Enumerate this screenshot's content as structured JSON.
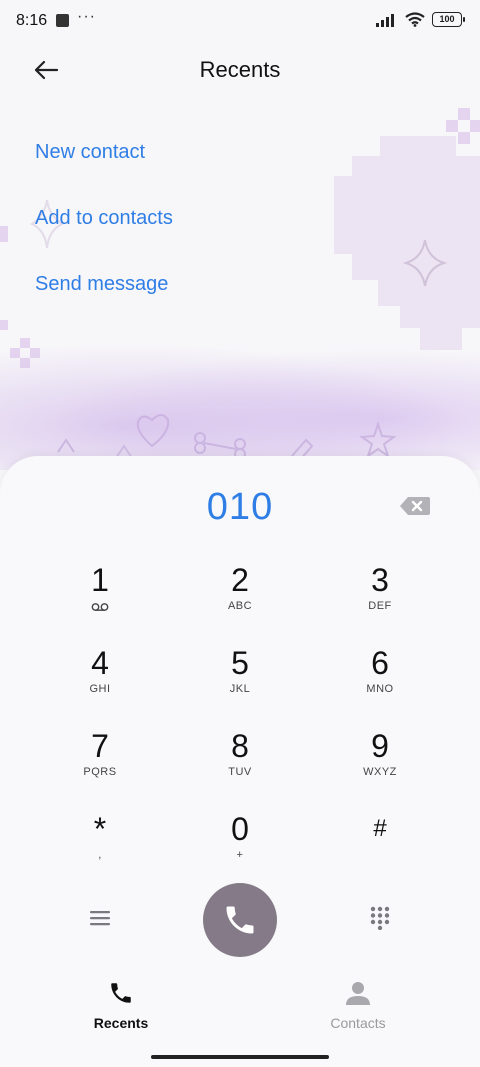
{
  "status_bar": {
    "time": "8:16",
    "dots": "···",
    "battery": "100"
  },
  "header": {
    "title": "Recents"
  },
  "actions": [
    {
      "label": "New contact"
    },
    {
      "label": "Add to contacts"
    },
    {
      "label": "Send message"
    }
  ],
  "dialer": {
    "number": "010",
    "keys": [
      {
        "digit": "1",
        "letters": ""
      },
      {
        "digit": "2",
        "letters": "ABC"
      },
      {
        "digit": "3",
        "letters": "DEF"
      },
      {
        "digit": "4",
        "letters": "GHI"
      },
      {
        "digit": "5",
        "letters": "JKL"
      },
      {
        "digit": "6",
        "letters": "MNO"
      },
      {
        "digit": "7",
        "letters": "PQRS"
      },
      {
        "digit": "8",
        "letters": "TUV"
      },
      {
        "digit": "9",
        "letters": "WXYZ"
      },
      {
        "digit": "*",
        "letters": ","
      },
      {
        "digit": "0",
        "letters": "+"
      },
      {
        "digit": "#",
        "letters": ""
      }
    ]
  },
  "tabs": [
    {
      "label": "Recents",
      "active": true
    },
    {
      "label": "Contacts",
      "active": false
    }
  ],
  "colors": {
    "accent": "#2f7ee6",
    "call_button": "#857a87",
    "inactive_tab": "#9a9a9a"
  }
}
